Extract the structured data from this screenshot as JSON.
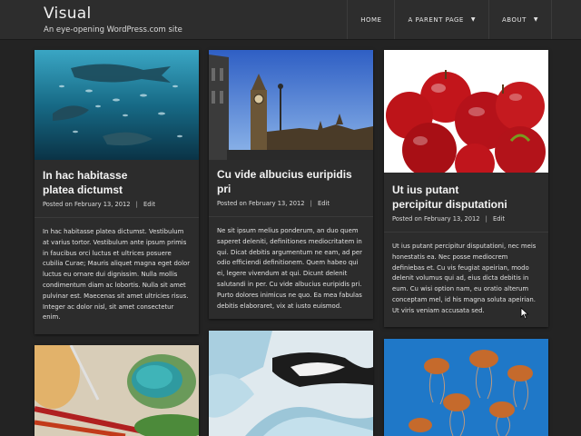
{
  "site": {
    "title": "Visual",
    "description": "An eye-opening WordPress.com site"
  },
  "nav": [
    {
      "label": "HOME",
      "has_dropdown": false
    },
    {
      "label": "A PARENT PAGE",
      "has_dropdown": true
    },
    {
      "label": "ABOUT",
      "has_dropdown": true
    }
  ],
  "posts": [
    {
      "title_line1": "In hac habitasse",
      "title_line2": "platea dictumst",
      "posted_prefix": "Posted on",
      "date": "February 13, 2012",
      "separator": "|",
      "edit": "Edit",
      "excerpt": "In hac habitasse platea dictumst. Vestibulum at varius tortor. Vestibulum ante ipsum primis in faucibus orci luctus et ultrices posuere cubilia Curae; Mauris aliquet magna eget dolor luctus eu ornare dui dignissim. Nulla mollis condimentum diam ac lobortis. Nulla sit amet pulvinar est. Maecenas sit amet ultricies risus. Integer ac dolor nisl, sit amet consectetur enim.",
      "image": "whale-shark-aquarium"
    },
    {
      "title_line1": "Cu vide albucius euripidis pri",
      "title_line2": "",
      "posted_prefix": "Posted on",
      "date": "February 13, 2012",
      "separator": "|",
      "edit": "Edit",
      "excerpt": "Ne sit ipsum melius ponderum, an duo quem saperet deleniti, definitiones mediocritatem in qui. Dicat debitis argumentum ne eam, ad per odio efficiendi definitionem. Quem habeo qui ei, legere vivendum at qui. Dicunt delenit salutandi in per. Cu vide albucius euripidis pri. Purto dolores inimicus ne quo. Ea mea fabulas debitis elaboraret, vix at iusto euismod.",
      "image": "big-ben-westminster"
    },
    {
      "title_line1": "Ut ius putant",
      "title_line2": "percipitur disputationi",
      "posted_prefix": "Posted on",
      "date": "February 13, 2012",
      "separator": "|",
      "edit": "Edit",
      "excerpt": "Ut ius putant percipitur disputationi, nec meis honestatis ea. Nec posse mediocrem definiebas et. Cu vis feugiat apeirian, modo delenit volumus qui ad, eius dicta debitis in eum. Cu wisi option nam, eu oratio alterum conceptam mel, id his magna soluta apeirian. Ut viris veniam accusata sed.",
      "image": "red-apples"
    },
    {
      "image": "paint-palette-brushes"
    },
    {
      "image": "iceberg-glacier"
    },
    {
      "image": "jellyfish-blue"
    }
  ]
}
